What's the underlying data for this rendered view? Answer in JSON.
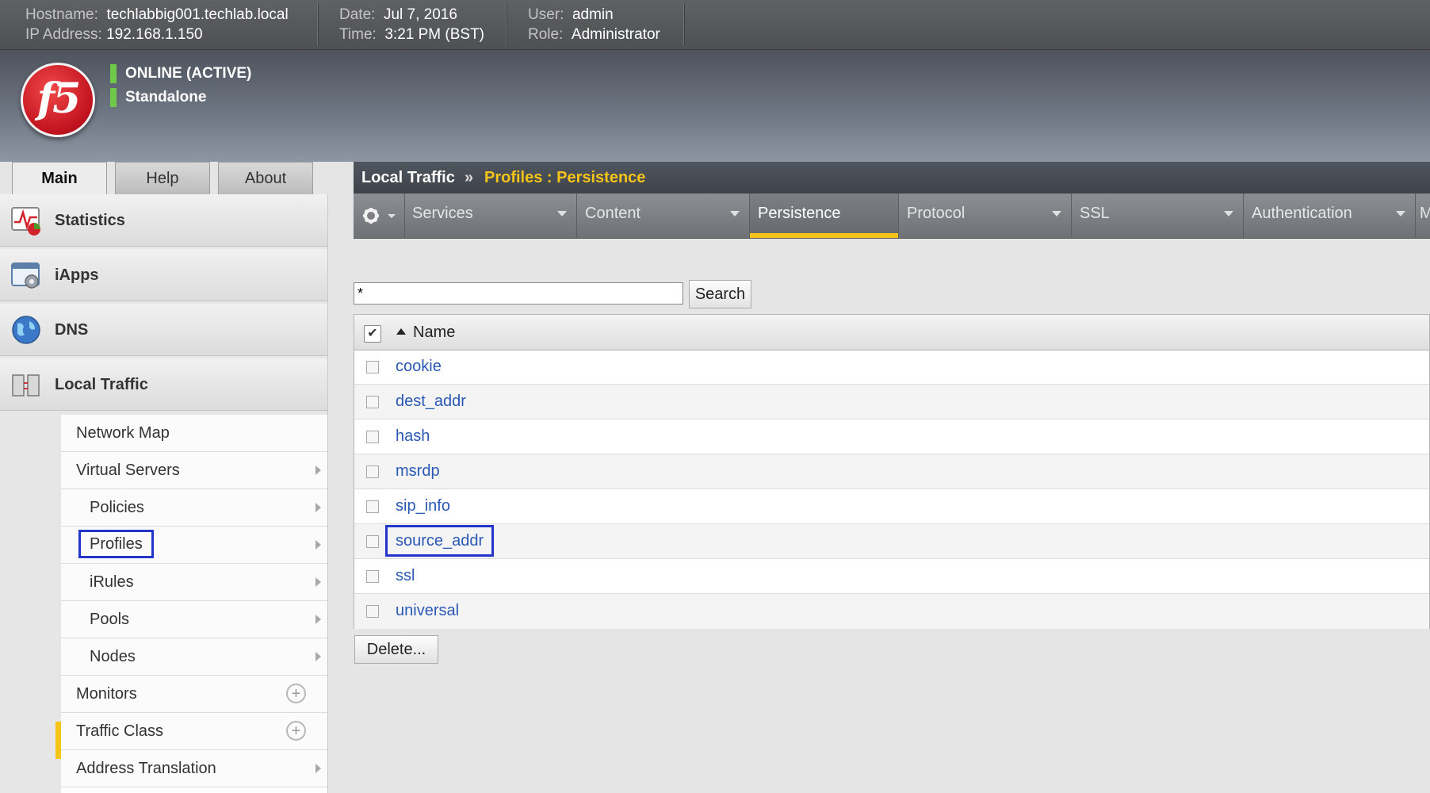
{
  "topbar": {
    "hostname_label": "Hostname:",
    "hostname": "techlabbig001.techlab.local",
    "ip_label": "IP Address:",
    "ip": "192.168.1.150",
    "date_label": "Date:",
    "date": "Jul 7, 2016",
    "time_label": "Time:",
    "time": "3:21 PM (BST)",
    "user_label": "User:",
    "user": "admin",
    "role_label": "Role:",
    "role": "Administrator"
  },
  "banner": {
    "logo_text": "f5",
    "status_online": "ONLINE (ACTIVE)",
    "status_mode": "Standalone",
    "status_color": "#6fc84a"
  },
  "main_tabs": [
    "Main",
    "Help",
    "About"
  ],
  "sidebar": {
    "categories": [
      {
        "label": "Statistics",
        "icon": "statistics-icon"
      },
      {
        "label": "iApps",
        "icon": "iapps-icon"
      },
      {
        "label": "DNS",
        "icon": "dns-globe-icon"
      },
      {
        "label": "Local Traffic",
        "icon": "local-traffic-icon"
      }
    ],
    "submenu": [
      {
        "label": "Network Map"
      },
      {
        "label": "Virtual Servers"
      },
      {
        "label": "Policies"
      },
      {
        "label": "Profiles"
      },
      {
        "label": "iRules"
      },
      {
        "label": "Pools"
      },
      {
        "label": "Nodes"
      },
      {
        "label": "Monitors"
      },
      {
        "label": "Traffic Class"
      },
      {
        "label": "Address Translation"
      }
    ],
    "selected": "Profiles",
    "accent_color": "#f6c318"
  },
  "breadcrumb": {
    "section": "Local Traffic",
    "separator": "»",
    "page": "Profiles : Persistence"
  },
  "subnav": {
    "gear_icon": "gear-icon",
    "items": [
      {
        "label": "Services"
      },
      {
        "label": "Content"
      },
      {
        "label": "Persistence"
      },
      {
        "label": "Protocol"
      },
      {
        "label": "SSL"
      },
      {
        "label": "Authentication"
      },
      {
        "label": "M"
      }
    ],
    "active": "Persistence"
  },
  "search": {
    "value": "*",
    "button": "Search"
  },
  "table": {
    "column_name": "Name",
    "sort": "ascending",
    "rows": [
      "cookie",
      "dest_addr",
      "hash",
      "msrdp",
      "sip_info",
      "source_addr",
      "ssl",
      "universal"
    ],
    "highlighted_row": "source_addr",
    "link_color": "#2a58b5"
  },
  "actions": {
    "delete": "Delete..."
  }
}
